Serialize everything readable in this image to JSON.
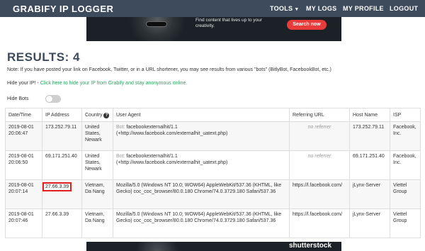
{
  "navbar": {
    "brand": "GRABIFY IP LOGGER",
    "items": [
      {
        "label": "TOOLS"
      },
      {
        "label": "MY LOGS"
      },
      {
        "label": "MY PROFILE"
      },
      {
        "label": "LOGOUT"
      }
    ]
  },
  "ad_top": {
    "text": "Find content that lives up to your creativity.",
    "button": "Search now",
    "brand": "shutterstock",
    "icons": [
      "camera-icon",
      "image-icon",
      "play-icon",
      "music-icon"
    ]
  },
  "results": {
    "heading": "RESULTS: 4",
    "note": "Note: If you have posted your link on Facebook, Twitter, or in a URL shortener, you may see results from various \"bots\" (BitlyBot, FacebookBot, etc.)",
    "hide_ip_label": "Hide your IP! -",
    "hide_ip_link": "Click here to hide your IP from Grabify and stay anonymous online.",
    "hide_bots_label": "Hide Bots",
    "hide_bots_enabled": false
  },
  "table": {
    "headers": [
      "Date/Time",
      "IP Address",
      "Country",
      "User Agent",
      "Referring URL",
      "Host Name",
      "ISP"
    ],
    "rows": [
      {
        "datetime": "2019-08-01 20:06:47",
        "ip": "173.252.79.11",
        "country": "United States, Newark",
        "bot": "Bot:",
        "ua": "facebookexternalhit/1.1 (+http://www.facebook.com/externalhit_uatext.php)",
        "ref": "no referrer",
        "host": "173.252.79.11",
        "isp": "Facebook, Inc."
      },
      {
        "datetime": "2019-08-01 20:06:50",
        "ip": "69.171.251.40",
        "country": "United States, Newark",
        "bot": "Bot:",
        "ua": "facebookexternalhit/1.1 (+http://www.facebook.com/externalhit_uatext.php)",
        "ref": "no referrer",
        "host": "69.171.251.40",
        "isp": "Facebook, Inc."
      },
      {
        "datetime": "2019-08-01 20:07:14",
        "ip": "27.66.3.39",
        "country": "Vietnam, Da Nang",
        "ua": "Mozilla/5.0 (Windows NT 10.0; WOW64) AppleWebKit/537.36 (KHTML, like Gecko) coc_coc_browser/80.0.180 Chrome/74.0.3729.180 Safari/537.36",
        "ref": "https://l.facebook.com/",
        "host": "jLynx-Server",
        "isp": "Viettel Group"
      },
      {
        "datetime": "2019-08-01 20:07:46",
        "ip": "27.66.3.39",
        "country": "Vietnam, Da Nang",
        "ua": "Mozilla/5.0 (Windows NT 10.0; WOW64) AppleWebKit/537.36 (KHTML, like Gecko) coc_coc_browser/80.0.180 Chrome/74.0.3729.180 Safari/537.36",
        "ref": "https://l.facebook.com/",
        "host": "jLynx-Server",
        "isp": "Viettel Group"
      }
    ]
  },
  "ad_bottom": {
    "brand": "shutterstock"
  },
  "colors": {
    "navbar": "#3d4b5c",
    "link_green": "#26a65b",
    "ad_button": "#ea3b3b",
    "highlight_red": "#e02020"
  }
}
